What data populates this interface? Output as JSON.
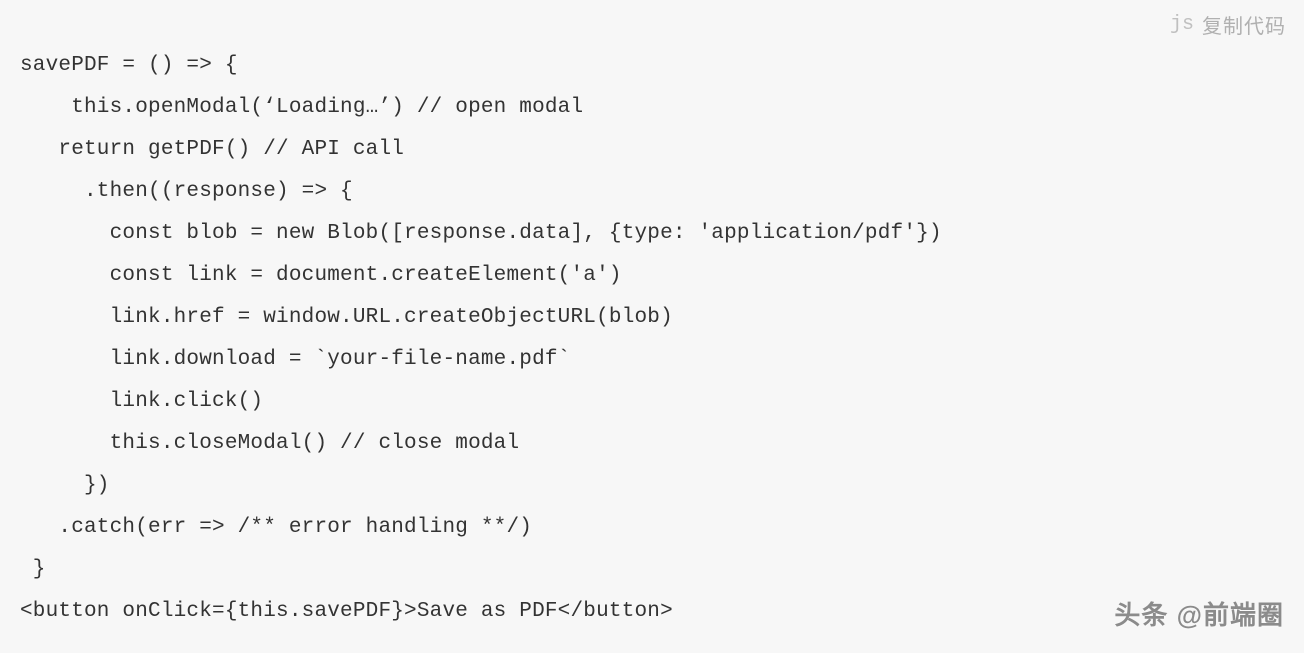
{
  "meta": {
    "language": "js",
    "copy_label": "复制代码"
  },
  "code": "savePDF = () => {\n    this.openModal(‘Loading…’) // open modal\n   return getPDF() // API call\n     .then((response) => {\n       const blob = new Blob([response.data], {type: 'application/pdf'})\n       const link = document.createElement('a')\n       link.href = window.URL.createObjectURL(blob)\n       link.download = `your-file-name.pdf`\n       link.click()\n       this.closeModal() // close modal\n     })\n   .catch(err => /** error handling **/)\n }\n<button onClick={this.savePDF}>Save as PDF</button>",
  "watermark": "头条 @前端圈"
}
